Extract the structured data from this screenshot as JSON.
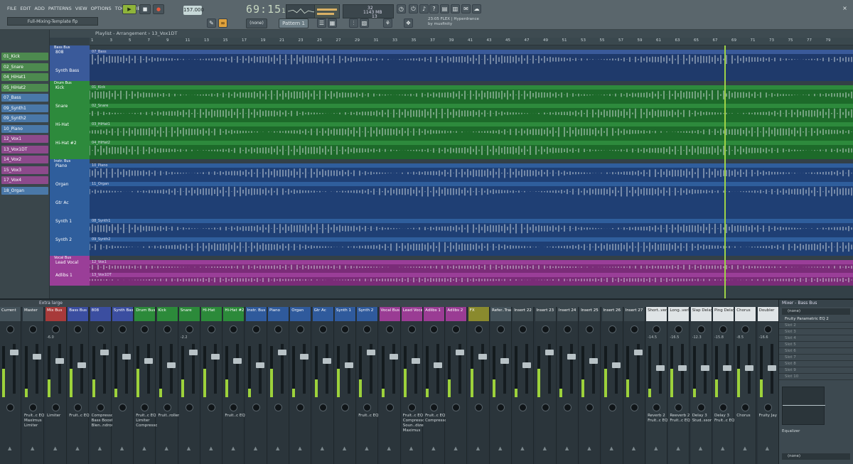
{
  "menu": [
    "FILE",
    "EDIT",
    "ADD",
    "PATTERNS",
    "VIEW",
    "OPTIONS",
    "TOOLS",
    "HELP"
  ],
  "hint": "Full-Mixing-Template flp",
  "transport": {
    "tempo": "157.000",
    "time": "69:15",
    "time_small": "18",
    "pattern": "Pattern 1",
    "snap": "(none)",
    "cpu": "32",
    "mem": "1143 MB",
    "poly": "13"
  },
  "news": {
    "line1": "23:05 FLEX | Hyperdrance",
    "line2": "by musfinity"
  },
  "playlist": {
    "title": "Playlist - Arrangement › 13_Vox1DT",
    "ruler": [
      "1",
      "3",
      "5",
      "7",
      "9",
      "11",
      "13",
      "15",
      "17",
      "19",
      "21",
      "23",
      "25",
      "27",
      "29",
      "31",
      "33",
      "35",
      "37",
      "39",
      "41",
      "43",
      "45",
      "47",
      "49",
      "51",
      "53",
      "55",
      "57",
      "59",
      "61",
      "63",
      "65",
      "67",
      "69",
      "71",
      "73",
      "75",
      "77",
      "79"
    ]
  },
  "browser_channels": [
    {
      "label": "01_Kick",
      "color": "#4d8a4f"
    },
    {
      "label": "02_Snare",
      "color": "#4d8a4f"
    },
    {
      "label": "04_HiHat1",
      "color": "#4d8a4f"
    },
    {
      "label": "05_HiHat2",
      "color": "#4d8a4f"
    },
    {
      "label": "07_Bass",
      "color": "#4a78a8"
    },
    {
      "label": "09_Synth1",
      "color": "#4a78a8"
    },
    {
      "label": "09_Synth2",
      "color": "#4a78a8"
    },
    {
      "label": "10_Piano",
      "color": "#4a78a8"
    },
    {
      "label": "12_Vox1",
      "color": "#8d4a8c"
    },
    {
      "label": "13_Vox1DT",
      "color": "#8d4a8c"
    },
    {
      "label": "14_Vox2",
      "color": "#8d4a8c"
    },
    {
      "label": "15_Vox3",
      "color": "#8d4a8c"
    },
    {
      "label": "17_Vox4",
      "color": "#8d4a8c"
    },
    {
      "label": "18_Organ",
      "color": "#4a78a8"
    }
  ],
  "groups": [
    {
      "bus": "Bass Bus",
      "color": "#3a5a9a",
      "tracks": [
        {
          "name": "808",
          "clip": "07_Bass"
        },
        {
          "name": "Synth Bass",
          "clip": ""
        }
      ]
    },
    {
      "bus": "Drum Bus",
      "color": "#2d8a3c",
      "tracks": [
        {
          "name": "Kick",
          "clip": "01_Kick"
        },
        {
          "name": "Snare",
          "clip": "02_Snare"
        },
        {
          "name": "Hi-Hat",
          "clip": "03_HiHat1"
        },
        {
          "name": "Hi-Hat #2",
          "clip": "04_HiHat2"
        }
      ]
    },
    {
      "bus": "Instr. Bus",
      "color": "#2f5e9c",
      "tracks": [
        {
          "name": "Piano",
          "clip": "10_Piano"
        },
        {
          "name": "Organ",
          "clip": "11_Organ"
        },
        {
          "name": "Gtr Ac",
          "clip": ""
        },
        {
          "name": "Synth 1",
          "clip": "08_Synth1"
        },
        {
          "name": "Synth 2",
          "clip": "09_Synth2"
        }
      ]
    },
    {
      "bus": "Vocal Bus",
      "color": "#9a3e98",
      "tracks": [
        {
          "name": "Lead Vocal",
          "clip": "12_Vox1"
        },
        {
          "name": "Adlibs 1",
          "clip": "13_Vox1DT"
        }
      ]
    }
  ],
  "mixer": {
    "toolbar": "Extra large",
    "strips": [
      {
        "name": "Current",
        "sub": "",
        "color": "#44525a",
        "fx": []
      },
      {
        "name": "Master",
        "sub": "",
        "color": "#44525a",
        "fx": [
          "Fruit..c EQ 2",
          "Maximus",
          "Limiter"
        ]
      },
      {
        "name": "Mix Bus",
        "sub": "-6.0",
        "color": "#a83a3a",
        "fx": [
          "Limiter"
        ]
      },
      {
        "name": "Bass Bus",
        "sub": "",
        "color": "#3b4ea0",
        "fx": [
          "Fruit..c EQ 2"
        ]
      },
      {
        "name": "808",
        "sub": "",
        "color": "#3b4ea0",
        "fx": [
          "Compressor",
          "Bass Boost",
          "Blen..ndrow"
        ]
      },
      {
        "name": "Synth Bass",
        "sub": "",
        "color": "#3b4ea0",
        "fx": []
      },
      {
        "name": "Drum Bus",
        "sub": "",
        "color": "#2c8a3a",
        "fx": [
          "Fruit..c EQ 2",
          "Limiter",
          "Compressor"
        ]
      },
      {
        "name": "Kick",
        "sub": "",
        "color": "#2c8a3a",
        "fx": [
          "Fruit..roller"
        ]
      },
      {
        "name": "Snare",
        "sub": "-2.2",
        "color": "#2c8a3a",
        "fx": []
      },
      {
        "name": "Hi-Hat",
        "sub": "",
        "color": "#2c8a3a",
        "fx": []
      },
      {
        "name": "Hi-Hat #2",
        "sub": "",
        "color": "#2c8a3a",
        "fx": [
          "Fruit..c EQ 2"
        ]
      },
      {
        "name": "Instr. Bus",
        "sub": "",
        "color": "#2f5a9c",
        "fx": []
      },
      {
        "name": "Piano",
        "sub": "",
        "color": "#2f5a9c",
        "fx": []
      },
      {
        "name": "Organ",
        "sub": "",
        "color": "#2f5a9c",
        "fx": []
      },
      {
        "name": "Gtr Ac",
        "sub": "",
        "color": "#2f5a9c",
        "fx": []
      },
      {
        "name": "Synth 1",
        "sub": "",
        "color": "#2f5a9c",
        "fx": []
      },
      {
        "name": "Synth 2",
        "sub": "",
        "color": "#2f5a9c",
        "fx": [
          "Fruit..c EQ 2"
        ]
      },
      {
        "name": "Vocal Bus",
        "sub": "",
        "color": "#9a3c94",
        "fx": []
      },
      {
        "name": "Lead Vocal",
        "sub": "",
        "color": "#9a3c94",
        "fx": [
          "Fruit..c EQ 2",
          "Compressor",
          "Soun..dizer",
          "Maximus"
        ]
      },
      {
        "name": "Adlibs 1",
        "sub": "",
        "color": "#9a3c94",
        "fx": [
          "Fruit..c EQ 2",
          "Compressor"
        ]
      },
      {
        "name": "Adlibs 2",
        "sub": "",
        "color": "#9a3c94",
        "fx": []
      },
      {
        "name": "FX",
        "sub": "",
        "color": "#8a8a2e",
        "fx": []
      },
      {
        "name": "Refer..Track",
        "sub": "",
        "color": "#44525a",
        "fx": []
      },
      {
        "name": "Insert 22",
        "sub": "",
        "color": "#3a464c",
        "fx": []
      },
      {
        "name": "Insert 23",
        "sub": "",
        "color": "#3a464c",
        "fx": []
      },
      {
        "name": "Insert 24",
        "sub": "",
        "color": "#3a464c",
        "fx": []
      },
      {
        "name": "Insert 25",
        "sub": "",
        "color": "#3a464c",
        "fx": []
      },
      {
        "name": "Insert 26",
        "sub": "",
        "color": "#3a464c",
        "fx": []
      },
      {
        "name": "Insert 27",
        "sub": "",
        "color": "#3a464c",
        "fx": []
      },
      {
        "name": "Short..verb",
        "sub": "-14.5",
        "color": "#dfe4e6",
        "fx": [
          "Reverb 2",
          "Fruit..c EQ 2"
        ]
      },
      {
        "name": "Long..verb",
        "sub": "-16.5",
        "color": "#dfe4e6",
        "fx": [
          "Reeverb 2",
          "Fruit..c EQ 2"
        ]
      },
      {
        "name": "Slap Delay",
        "sub": "-12.3",
        "color": "#dfe4e6",
        "fx": [
          "Delay 3",
          "Stud..ssor"
        ]
      },
      {
        "name": "Ping Delay",
        "sub": "-15.8",
        "color": "#dfe4e6",
        "fx": [
          "Delay 3",
          "Fruit..c EQ 2"
        ]
      },
      {
        "name": "Chorus",
        "sub": "-8.5",
        "color": "#dfe4e6",
        "fx": [
          "Chorus"
        ]
      },
      {
        "name": "Doubler",
        "sub": "-16.6",
        "color": "#dfe4e6",
        "fx": [
          "Fruity Jay 2"
        ]
      }
    ],
    "inserts": {
      "title": "Mixer - Bass Bus",
      "input": "(none)",
      "output": "(none)",
      "slots": [
        "Fruity Parametric EQ 2",
        "Slot 2",
        "Slot 3",
        "Slot 4",
        "Slot 5",
        "Slot 6",
        "Slot 7",
        "Slot 8",
        "Slot 9",
        "Slot 10"
      ],
      "eq_label": "Equalizer"
    }
  }
}
